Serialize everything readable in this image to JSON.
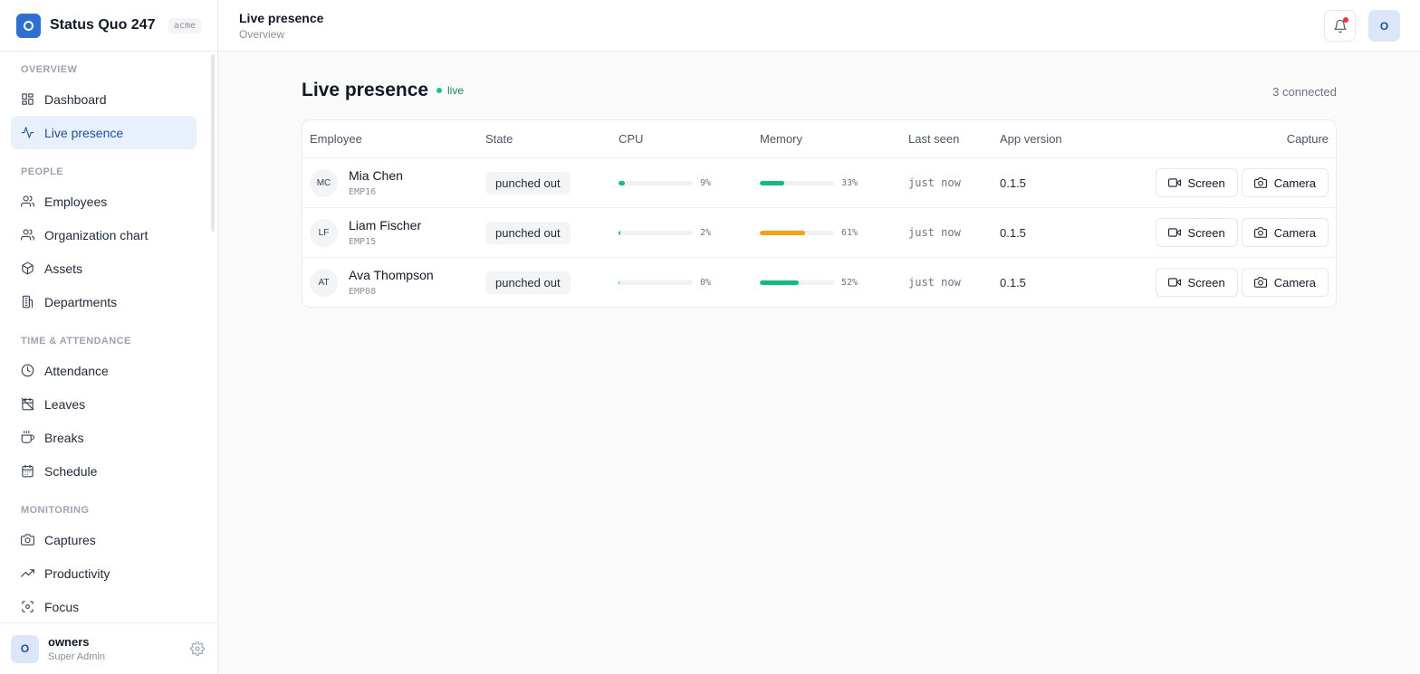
{
  "brand": {
    "name": "Status Quo 247",
    "org": "acme"
  },
  "sidebar": {
    "sections": [
      {
        "label": "OVERVIEW",
        "items": [
          {
            "label": "Dashboard",
            "icon": "dashboard-icon",
            "active": false
          },
          {
            "label": "Live presence",
            "icon": "activity-icon",
            "active": true
          }
        ]
      },
      {
        "label": "PEOPLE",
        "items": [
          {
            "label": "Employees",
            "icon": "users-icon",
            "active": false
          },
          {
            "label": "Organization chart",
            "icon": "users-icon",
            "active": false
          },
          {
            "label": "Assets",
            "icon": "box-icon",
            "active": false
          },
          {
            "label": "Departments",
            "icon": "building-icon",
            "active": false
          }
        ]
      },
      {
        "label": "TIME & ATTENDANCE",
        "items": [
          {
            "label": "Attendance",
            "icon": "clock-icon",
            "active": false
          },
          {
            "label": "Leaves",
            "icon": "calendar-off-icon",
            "active": false
          },
          {
            "label": "Breaks",
            "icon": "coffee-icon",
            "active": false
          },
          {
            "label": "Schedule",
            "icon": "calendar-icon",
            "active": false
          }
        ]
      },
      {
        "label": "MONITORING",
        "items": [
          {
            "label": "Captures",
            "icon": "camera-icon",
            "active": false
          },
          {
            "label": "Productivity",
            "icon": "trending-up-icon",
            "active": false
          },
          {
            "label": "Focus",
            "icon": "focus-icon",
            "active": false
          }
        ]
      }
    ]
  },
  "user": {
    "initial": "O",
    "name": "owners",
    "role": "Super Admin"
  },
  "topbar": {
    "title": "Live presence",
    "subtitle": "Overview",
    "avatar_initial": "O"
  },
  "main": {
    "heading": "Live presence",
    "live_label": "live",
    "connected": "3 connected"
  },
  "table": {
    "columns": [
      "Employee",
      "State",
      "CPU",
      "Memory",
      "Last seen",
      "App version",
      "Capture"
    ],
    "rows": [
      {
        "initials": "MC",
        "name": "Mia Chen",
        "id": "EMP16",
        "state": "punched out",
        "cpu": 9,
        "cpu_label": "9%",
        "mem": 33,
        "mem_label": "33%",
        "mem_color": "#16b981",
        "last_seen": "just now",
        "version": "0.1.5"
      },
      {
        "initials": "LF",
        "name": "Liam Fischer",
        "id": "EMP15",
        "state": "punched out",
        "cpu": 2,
        "cpu_label": "2%",
        "mem": 61,
        "mem_label": "61%",
        "mem_color": "#f5a017",
        "last_seen": "just now",
        "version": "0.1.5"
      },
      {
        "initials": "AT",
        "name": "Ava Thompson",
        "id": "EMP08",
        "state": "punched out",
        "cpu": 0,
        "cpu_label": "0%",
        "mem": 52,
        "mem_label": "52%",
        "mem_color": "#16b981",
        "last_seen": "just now",
        "version": "0.1.5"
      }
    ],
    "screen_label": "Screen",
    "camera_label": "Camera",
    "cpu_color": "#16b981"
  }
}
